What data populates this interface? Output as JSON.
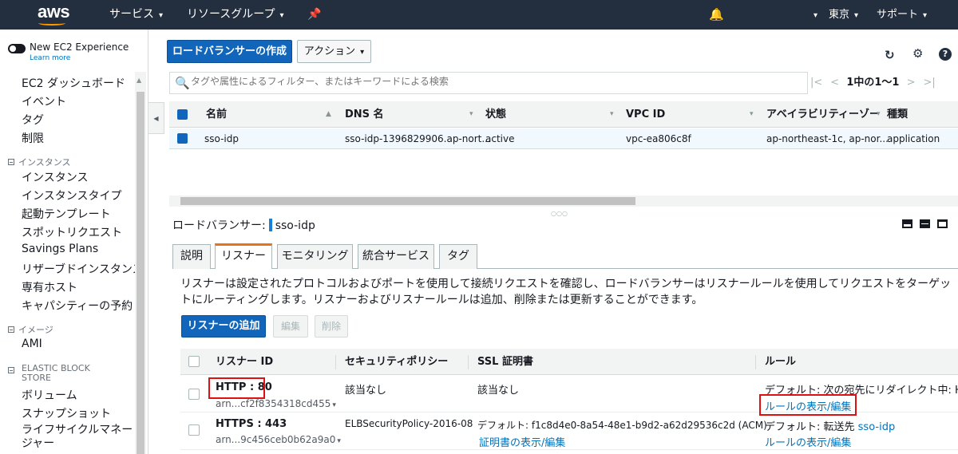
{
  "topnav": {
    "logo": "aws",
    "services": "サービス",
    "resource_groups": "リソースグループ",
    "region": "東京",
    "support": "サポート"
  },
  "sidebar": {
    "toggle_label": "New EC2 Experience",
    "learn_more": "Learn more",
    "top_items": [
      "EC2 ダッシュボード",
      "イベント",
      "タグ",
      "制限"
    ],
    "sections": [
      {
        "title": "インスタンス",
        "items": [
          "インスタンス",
          "インスタンスタイプ",
          "起動テンプレート",
          "スポットリクエスト",
          "Savings Plans",
          "リザーブドインスタンス",
          "専有ホスト",
          "キャパシティーの予約"
        ]
      },
      {
        "title": "イメージ",
        "items": [
          "AMI"
        ]
      },
      {
        "title": "ELASTIC BLOCK STORE",
        "items": [
          "ボリューム",
          "スナップショット",
          "ライフサイクルマネージャー"
        ]
      }
    ]
  },
  "toolbar": {
    "create_lb": "ロードバランサーの作成",
    "actions": "アクション"
  },
  "filter": {
    "placeholder": "タグや属性によるフィルター、またはキーワードによる検索"
  },
  "pager": {
    "text": "1中の1～1"
  },
  "lb_table": {
    "headers": [
      "名前",
      "DNS 名",
      "状態",
      "VPC ID",
      "アベイラビリティーゾー",
      "種類"
    ],
    "rows": [
      {
        "name": "sso-idp",
        "dns": "sso-idp-1396829906.ap-nort...",
        "state": "active",
        "vpc": "vpc-ea806c8f",
        "az": "ap-northeast-1c, ap-nor...",
        "type": "application"
      }
    ]
  },
  "detail": {
    "label": "ロードバランサー:",
    "lb_name": "sso-idp",
    "tabs": [
      "説明",
      "リスナー",
      "モニタリング",
      "統合サービス",
      "タグ"
    ],
    "active_tab": "リスナー",
    "description": "リスナーは設定されたプロトコルおよびポートを使用して接続リクエストを確認し、ロードバランサーはリスナールールを使用してリクエストをターゲットにルーティングします。リスナーおよびリスナールールは追加、削除または更新することができます。",
    "add_listener": "リスナーの追加",
    "edit": "編集",
    "delete": "削除"
  },
  "listeners": {
    "headers": [
      "リスナー ID",
      "セキュリティポリシー",
      "SSL 証明書",
      "ルール"
    ],
    "rows": [
      {
        "id": "HTTP : 80",
        "arn": "arn...cf2f8354318cd455",
        "policy": "該当なし",
        "cert": "該当なし",
        "rule": "デフォルト: 次の宛先にリダイレクト中: HT",
        "rule_link": "ルールの表示/編集"
      },
      {
        "id": "HTTPS : 443",
        "arn": "arn...9c456ceb0b62a9a0",
        "policy": "ELBSecurityPolicy-2016-08",
        "cert": "デフォルト: f1c8d4e0-8a54-48e1-b9d2-a62d29536c2d (ACM)",
        "cert_link": "証明書の表示/編集",
        "rule_prefix": "デフォルト: 転送先",
        "rule_target": "sso-idp",
        "rule_link": "ルールの表示/編集"
      }
    ]
  },
  "colors": {
    "nav_bg": "#232f3e",
    "primary": "#1166bb",
    "tab_accent": "#ec7211",
    "highlight": "#dd1111",
    "link": "#0073bb"
  }
}
